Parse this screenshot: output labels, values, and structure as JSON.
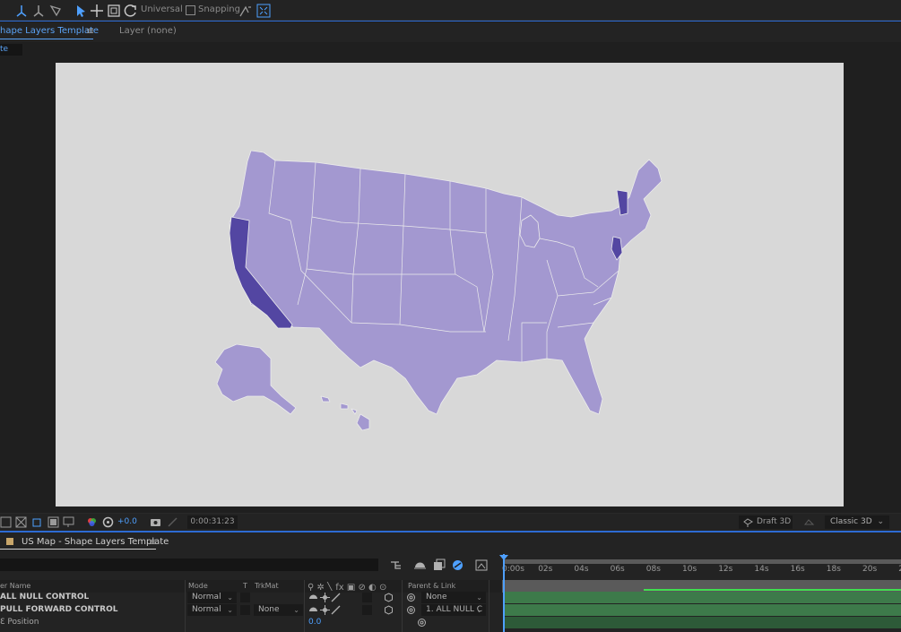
{
  "toolbar": {
    "universal_label": "Universal",
    "snapping_label": "Snapping"
  },
  "comp_tabs": {
    "active_tab": "hape Layers Template",
    "layer_tab": "Layer (none)",
    "breadcrumb": "te"
  },
  "map": {
    "base_color": "#a398d0",
    "highlight_color": "#5346a2",
    "highlighted_states": [
      "California",
      "Vermont",
      "New Jersey"
    ]
  },
  "viewer_bar": {
    "exposure": "+0.0",
    "timecode": "0:00:31:23",
    "draft3d_label": "Draft 3D",
    "renderer": "Classic 3D"
  },
  "timeline": {
    "comp_title": "US Map - Shape Layers Template",
    "columns": {
      "layer_name": "er Name",
      "mode": "Mode",
      "t": "T",
      "trkmat": "TrkMat",
      "parent": "Parent & Link"
    },
    "time_labels": [
      "0:00s",
      "02s",
      "04s",
      "06s",
      "08s",
      "10s",
      "12s",
      "14s",
      "16s",
      "18s",
      "20s",
      "2"
    ],
    "rows": [
      {
        "name": "ALL NULL CONTROL",
        "mode": "Normal",
        "trkmat": "",
        "parent": "None"
      },
      {
        "name": "PULL FORWARD CONTROL",
        "mode": "Normal",
        "trkmat": "None",
        "parent": "1. ALL NULL C"
      }
    ],
    "property": {
      "name": "Position",
      "value": "0.0"
    }
  }
}
